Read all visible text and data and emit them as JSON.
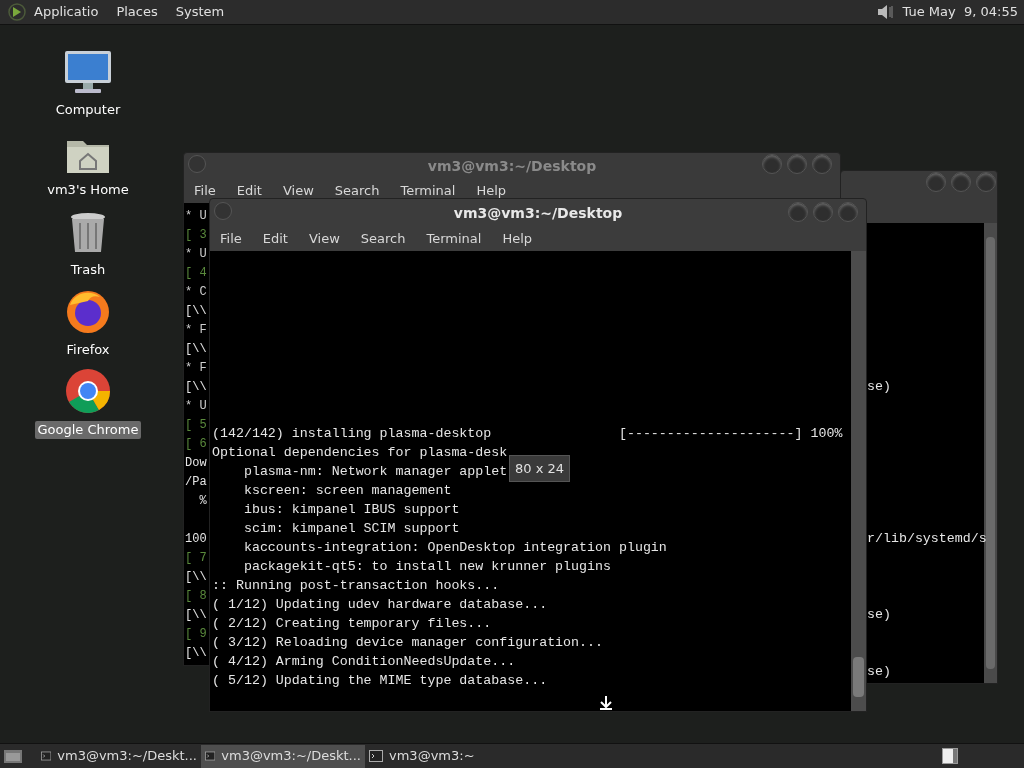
{
  "top_panel": {
    "menus": [
      "Applicatio",
      "Places",
      "System"
    ],
    "clock": "Tue May  9, 04:55"
  },
  "desktop_icons": [
    {
      "kind": "computer",
      "label": "Computer",
      "selected": false
    },
    {
      "kind": "home",
      "label": "vm3's Home",
      "selected": false
    },
    {
      "kind": "trash",
      "label": "Trash",
      "selected": false
    },
    {
      "kind": "firefox",
      "label": "Firefox",
      "selected": false
    },
    {
      "kind": "chrome",
      "label": "Google Chrome",
      "selected": true
    }
  ],
  "back_window": {
    "lines": [
      "se)",
      "r/lib/systemd/s",
      "se)",
      "se)"
    ]
  },
  "middle_window": {
    "title": "vm3@vm3:~/Desktop",
    "active": false,
    "menus": [
      "File",
      "Edit",
      "View",
      "Search",
      "Terminal",
      "Help"
    ],
    "lines": [
      {
        "kind": "bullet",
        "text": "* U"
      },
      {
        "kind": "step",
        "text": "[ 3"
      },
      {
        "kind": "bullet",
        "text": "* U"
      },
      {
        "kind": "step",
        "text": "[ 4"
      },
      {
        "kind": "bullet",
        "text": "* C"
      },
      {
        "kind": "plain",
        "text": "[\\\\"
      },
      {
        "kind": "bullet",
        "text": "* F"
      },
      {
        "kind": "plain",
        "text": "[\\\\"
      },
      {
        "kind": "bullet",
        "text": "* F"
      },
      {
        "kind": "plain",
        "text": "[\\\\"
      },
      {
        "kind": "bullet",
        "text": "* U"
      },
      {
        "kind": "step",
        "text": "[ 5"
      },
      {
        "kind": "step",
        "text": "[ 6"
      },
      {
        "kind": "plain",
        "text": "Dow"
      },
      {
        "kind": "plain",
        "text": "/Pa"
      },
      {
        "kind": "plain",
        "text": "  %"
      },
      {
        "kind": "plain",
        "text": "100"
      },
      {
        "kind": "step",
        "text": "[ 7"
      },
      {
        "kind": "plain",
        "text": "[\\\\"
      },
      {
        "kind": "step",
        "text": "[ 8"
      },
      {
        "kind": "plain",
        "text": "[\\\\"
      },
      {
        "kind": "step",
        "text": "[ 9"
      },
      {
        "kind": "plain",
        "text": "[\\\\"
      }
    ]
  },
  "front_window": {
    "title": "vm3@vm3:~/Desktop",
    "active": true,
    "menus": [
      "File",
      "Edit",
      "View",
      "Search",
      "Terminal",
      "Help"
    ],
    "lines": [
      "(142/142) installing plasma-desktop                [---------------------] 100%",
      "Optional dependencies for plasma-desk",
      "    plasma-nm: Network manager applet",
      "    kscreen: screen management",
      "    ibus: kimpanel IBUS support",
      "    scim: kimpanel SCIM support",
      "    kaccounts-integration: OpenDesktop integration plugin",
      "    packagekit-qt5: to install new krunner plugins",
      ":: Running post-transaction hooks...",
      "( 1/12) Updating udev hardware database...",
      "( 2/12) Creating temporary files...",
      "( 3/12) Reloading device manager configuration...",
      "( 4/12) Arming ConditionNeedsUpdate...",
      "( 5/12) Updating the MIME type database..."
    ],
    "tooltip": "80 x 24"
  },
  "taskbar": {
    "tasks": [
      {
        "label": "vm3@vm3:~/Deskt...",
        "selected": false
      },
      {
        "label": "vm3@vm3:~/Deskt...",
        "selected": true
      },
      {
        "label": "vm3@vm3:~",
        "selected": false
      }
    ]
  }
}
